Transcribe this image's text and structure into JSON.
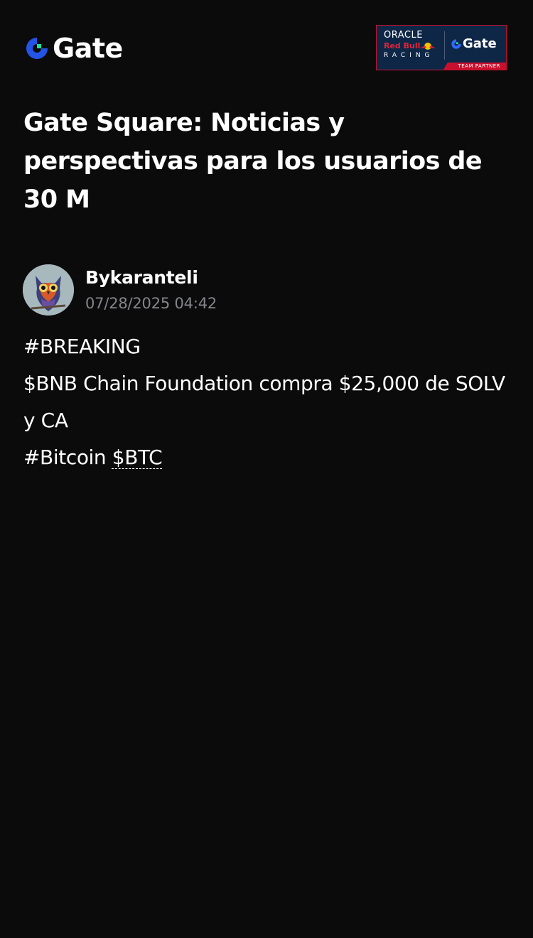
{
  "brand": {
    "name": "Gate",
    "logo_color_blue": "#2354e6",
    "logo_color_green": "#17e6a1"
  },
  "partner_badge": {
    "oracle": "ORACLE",
    "redbull": "Red Bull",
    "racing": "RACING",
    "gate": "Gate",
    "team_partner": "TEAM PARTNER",
    "background": "#0f2747",
    "accent": "#c8102e"
  },
  "page": {
    "title": "Gate Square: Noticias y perspectivas para los usuarios de 30 M"
  },
  "author": {
    "name": "Bykaranteli",
    "timestamp": "07/28/2025 04:42",
    "avatar_icon": "owl-avatar"
  },
  "post": {
    "line1": "#BREAKING",
    "line2": "$BNB Chain Foundation compra $25,000 de SOLV y CA",
    "line3_prefix": "#Bitcoin ",
    "line3_ticker": "$BTC"
  },
  "colors": {
    "background": "#0b0b0c",
    "text": "#ffffff",
    "muted": "#84868b"
  }
}
